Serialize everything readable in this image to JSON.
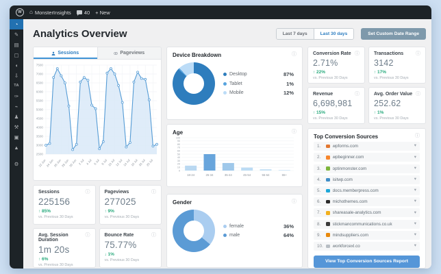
{
  "admin_bar": {
    "wp": "W",
    "site": "MonsterInsights",
    "comments": "40",
    "new": "+ New"
  },
  "sidebar": {
    "items": [
      {
        "icon": "dashboard-icon",
        "glyph": "◔",
        "active": true
      },
      {
        "icon": "posts-icon",
        "glyph": "✎"
      },
      {
        "icon": "media-icon",
        "glyph": "▤"
      },
      {
        "icon": "pages-icon",
        "glyph": "▢"
      },
      {
        "icon": "comments-icon",
        "glyph": "◖"
      },
      {
        "icon": "downloads-icon",
        "glyph": "⇩"
      },
      {
        "icon": "ta-plugin-icon",
        "glyph": "TA"
      },
      {
        "icon": "appearance-icon",
        "glyph": "✑"
      },
      {
        "icon": "plugins-icon",
        "glyph": "⌁"
      },
      {
        "icon": "users-icon",
        "glyph": "♟"
      },
      {
        "icon": "tools-icon",
        "glyph": "⚒"
      },
      {
        "icon": "editor-icon",
        "glyph": "▣"
      },
      {
        "icon": "analytics-icon",
        "glyph": "▲"
      },
      {
        "icon": "settings-icon",
        "glyph": "⚙",
        "gap": true
      }
    ]
  },
  "header": {
    "title": "Analytics Overview",
    "ranges": [
      {
        "label": "Last 7 days",
        "active": false
      },
      {
        "label": "Last 30 days",
        "active": true
      }
    ],
    "custom": "Set Custom Date Range"
  },
  "tabs": [
    {
      "label": "Sessions",
      "active": true
    },
    {
      "label": "Pageviews",
      "active": false
    }
  ],
  "metrics_left": [
    {
      "title": "Sessions",
      "value": "225156",
      "arrow": "↑",
      "change": "85%",
      "period": "vs. Previous 30 Days"
    },
    {
      "title": "Pageviews",
      "value": "277025",
      "arrow": "↑",
      "change": "9%",
      "period": "vs. Previous 30 Days"
    },
    {
      "title": "Avg. Session Duration",
      "value": "1m 20s",
      "arrow": "↑",
      "change": "6%",
      "period": "vs. Previous 30 Days"
    },
    {
      "title": "Bounce Rate",
      "value": "75.77%",
      "arrow": "↓",
      "change": "1%",
      "period": "vs. Previous 30 Days"
    }
  ],
  "metrics_right": [
    {
      "title": "Conversion Rate",
      "value": "2.71%",
      "arrow": "↑",
      "change": "22%",
      "period": "vs. Previous 30 Days"
    },
    {
      "title": "Transactions",
      "value": "3142",
      "arrow": "↑",
      "change": "17%",
      "period": "vs. Previous 30 Days"
    },
    {
      "title": "Revenue",
      "value": "6,698,981",
      "arrow": "↑",
      "change": "15%",
      "period": "vs. Previous 30 Days"
    },
    {
      "title": "Avg. Order Value",
      "value": "252.62",
      "arrow": "↑",
      "change": "1%",
      "period": "vs. Previous 30 Days"
    }
  ],
  "top_sources": {
    "title": "Top Conversion Sources",
    "button": "View Top Conversion Sources Report",
    "items": [
      {
        "rank": "1.",
        "domain": "wpforms.com",
        "color": "#e27730"
      },
      {
        "rank": "2.",
        "domain": "wpbeginner.com",
        "color": "#f7862c"
      },
      {
        "rank": "3.",
        "domain": "optinmonster.com",
        "color": "#7db53a"
      },
      {
        "rank": "4.",
        "domain": "isitwp.com",
        "color": "#3f8ec7"
      },
      {
        "rank": "5.",
        "domain": "docs.memberpress.com",
        "color": "#1da7d8"
      },
      {
        "rank": "6.",
        "domain": "michothemes.com",
        "color": "#2b2b2b"
      },
      {
        "rank": "7.",
        "domain": "shareasale-analytics.com",
        "color": "#f2b01e"
      },
      {
        "rank": "8.",
        "domain": "stickmancommunications.co.uk",
        "color": "#3a3a3a"
      },
      {
        "rank": "9.",
        "domain": "mindsuppliers.com",
        "color": "#e8890c"
      },
      {
        "rank": "10.",
        "domain": "workforcexl.co",
        "color": "#b8bec4"
      }
    ]
  },
  "chart_data": [
    {
      "type": "area",
      "title": "Sessions",
      "tick_labels": [
        "22 Jun",
        "24 Jun",
        "26 Jun",
        "28 Jun",
        "30 Jun",
        "2 Jul",
        "4 Jul",
        "6 Jul",
        "8 Jul",
        "10 Jul",
        "12 Jul",
        "14 Jul",
        "16 Jul",
        "18 Jul",
        "20 Jul"
      ],
      "values": [
        3000,
        3100,
        6800,
        7300,
        6900,
        6500,
        5200,
        2750,
        3050,
        6550,
        6800,
        6650,
        5250,
        5050,
        2800,
        3200,
        7050,
        7300,
        7000,
        6350,
        5400,
        2900,
        3150,
        6550,
        7100,
        6750,
        6700,
        5550,
        2950,
        3050
      ],
      "ylim": [
        2500,
        7500
      ],
      "ystep": 500,
      "line_color": "#549bd5",
      "fill_color": "#d9e9f8",
      "grid": true,
      "legend": "none"
    },
    {
      "type": "pie",
      "title": "Device Breakdown",
      "categories": [
        "Desktop",
        "Tablet",
        "Mobile"
      ],
      "values": [
        87,
        1,
        12
      ],
      "labels": [
        "87%",
        "1%",
        "12%"
      ],
      "colors": [
        "#2e7dbd",
        "#58a4de",
        "#bcdcf7"
      ],
      "legend": "right"
    },
    {
      "type": "bar",
      "title": "Age",
      "categories": [
        "18-24",
        "25-34",
        "35-44",
        "45-54",
        "55-64",
        "65+"
      ],
      "values": [
        15,
        50,
        23,
        9,
        4,
        2
      ],
      "ylim": [
        0,
        100
      ],
      "ystep": 10,
      "colors": [
        "#b9d8f1",
        "#68a5dc",
        "#9fc8ea",
        "#bcdcf4",
        "#c6e1f6",
        "#d2e8f9"
      ],
      "grid": true
    },
    {
      "type": "pie",
      "title": "Gender",
      "categories": [
        "female",
        "male"
      ],
      "values": [
        36,
        64
      ],
      "labels": [
        "36%",
        "64%"
      ],
      "colors": [
        "#aacdf0",
        "#5b9bd5"
      ],
      "legend": "right"
    }
  ]
}
